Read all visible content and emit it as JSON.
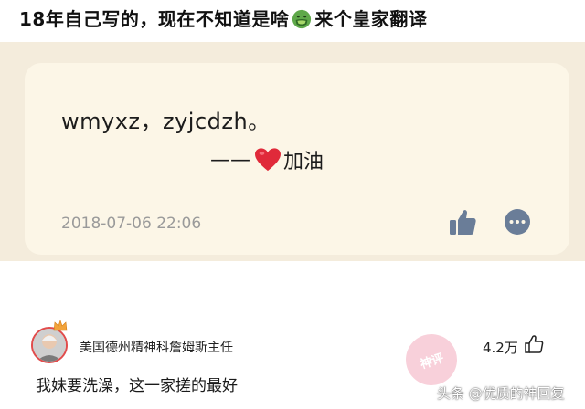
{
  "header": {
    "title_part1": "18年自己写的，现在不知道是啥",
    "title_part2": "来个皇家翻译"
  },
  "note": {
    "line1": "wmyxz，zyjcdzh。",
    "dash": "——",
    "cheer": "加油",
    "timestamp": "2018-07-06 22:06"
  },
  "comment": {
    "username": "美国德州精神科詹姆斯主任",
    "likes": "4.2万",
    "text": "我妹要洗澡，这一家搓的最好"
  },
  "watermark": {
    "text": "头条 @优质的神回复",
    "stamp_text": "神评"
  },
  "colors": {
    "band": "#f4ecdc",
    "card": "#fcf6e7",
    "heart": "#e02a3a",
    "icon_blue": "#6a7d98"
  }
}
